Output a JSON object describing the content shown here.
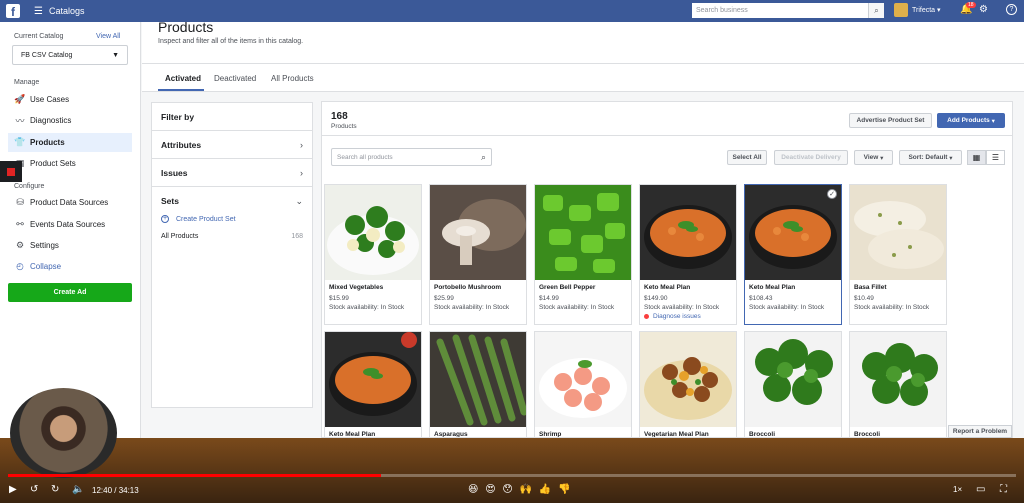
{
  "topbar": {
    "logo": "f",
    "menu_icon": "hamburger-icon",
    "title": "Catalogs",
    "search_placeholder": "Search business",
    "user_name": "Trifecta",
    "notification_count": "18"
  },
  "sidebar": {
    "current_catalog_label": "Current Catalog",
    "view_all": "View All",
    "catalog_name": "FB CSV Catalog",
    "manage_label": "Manage",
    "configure_label": "Configure",
    "manage_items": [
      {
        "label": "Use Cases",
        "icon": "rocket-icon"
      },
      {
        "label": "Diagnostics",
        "icon": "pulse-icon"
      },
      {
        "label": "Products",
        "icon": "shirt-icon"
      },
      {
        "label": "Product Sets",
        "icon": "grid-icon"
      }
    ],
    "configure_items": [
      {
        "label": "Product Data Sources",
        "icon": "database-icon"
      },
      {
        "label": "Events Data Sources",
        "icon": "events-icon"
      },
      {
        "label": "Settings",
        "icon": "gear-icon"
      },
      {
        "label": "Collapse",
        "icon": "collapse-icon"
      }
    ],
    "create_ad": "Create Ad"
  },
  "header": {
    "title": "Products",
    "subtitle": "Inspect and filter all of the items in this catalog."
  },
  "tabs": [
    "Activated",
    "Deactivated",
    "All Products"
  ],
  "filter": {
    "title": "Filter by",
    "attributes": "Attributes",
    "issues": "Issues",
    "sets": "Sets",
    "create_set": "Create Product Set",
    "all_products": "All Products",
    "all_count": "168"
  },
  "products": {
    "count": "168",
    "count_label": "Products",
    "advertise_set": "Advertise Product Set",
    "add_products": "Add Products",
    "search_placeholder": "Search all products",
    "select_all": "Select All",
    "deactivate": "Deactivate Delivery",
    "view": "View",
    "sort": "Sort: Default",
    "items": [
      {
        "name": "Mixed Vegetables",
        "price": "$15.99",
        "stock": "Stock availability: In Stock",
        "issue": ""
      },
      {
        "name": "Portobello Mushroom",
        "price": "$25.99",
        "stock": "Stock availability: In Stock",
        "issue": ""
      },
      {
        "name": "Green Bell Pepper",
        "price": "$14.99",
        "stock": "Stock availability: In Stock",
        "issue": ""
      },
      {
        "name": "Keto Meal Plan",
        "price": "$149.90",
        "stock": "Stock availability: In Stock",
        "issue": "Diagnose issues"
      },
      {
        "name": "Keto Meal Plan",
        "price": "$108.43",
        "stock": "Stock availability: In Stock",
        "issue": ""
      },
      {
        "name": "Basa Fillet",
        "price": "$10.49",
        "stock": "Stock availability: In Stock",
        "issue": ""
      },
      {
        "name": "Keto Meal Plan",
        "price": "",
        "stock": "",
        "issue": ""
      },
      {
        "name": "Asparagus",
        "price": "",
        "stock": "",
        "issue": ""
      },
      {
        "name": "Shrimp",
        "price": "",
        "stock": "",
        "issue": ""
      },
      {
        "name": "Vegetarian Meal Plan",
        "price": "",
        "stock": "",
        "issue": ""
      },
      {
        "name": "Broccoli",
        "price": "",
        "stock": "",
        "issue": ""
      },
      {
        "name": "Broccoli",
        "price": "",
        "stock": "",
        "issue": ""
      }
    ],
    "report_problem": "Report a Problem"
  },
  "player": {
    "time": "12:40 / 34:13",
    "progress": 0.37,
    "emojis": "😆 😍 😯 🙌 👍 👎",
    "speed": "1×"
  },
  "colors": {
    "brand": "#3b5998",
    "accent": "#4267b2",
    "create_ad": "#16a819",
    "progress": "#ff0000"
  }
}
